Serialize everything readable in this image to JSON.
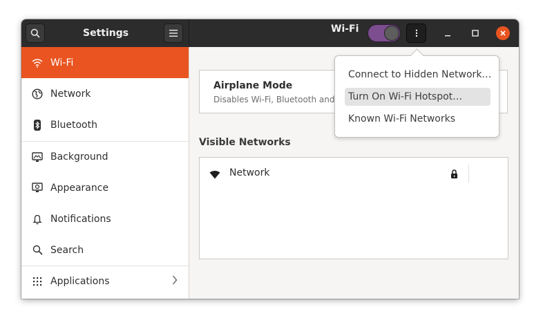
{
  "header": {
    "sidebar_title": "Settings",
    "page_title": "Wi-Fi",
    "wifi_switch_on": true
  },
  "sidebar": {
    "items": [
      {
        "label": "Wi-Fi",
        "icon": "wifi-icon",
        "active": true
      },
      {
        "label": "Network",
        "icon": "globe-icon"
      },
      {
        "label": "Bluetooth",
        "icon": "bluetooth-icon"
      },
      {
        "label": "Background",
        "icon": "monitor-icon"
      },
      {
        "label": "Appearance",
        "icon": "appearance-icon"
      },
      {
        "label": "Notifications",
        "icon": "bell-icon"
      },
      {
        "label": "Search",
        "icon": "search-icon"
      },
      {
        "label": "Applications",
        "icon": "apps-grid-icon"
      }
    ]
  },
  "main": {
    "airplane_title": "Airplane Mode",
    "airplane_subtitle": "Disables Wi-Fi, Bluetooth and",
    "visible_networks_label": "Visible Networks",
    "networks": [
      {
        "name": "Network",
        "secured": true
      }
    ]
  },
  "menu": {
    "items": [
      {
        "label": "Connect to Hidden Network…"
      },
      {
        "label": "Turn On Wi-Fi Hotspot…",
        "highlighted": true
      },
      {
        "label": "Known Wi-Fi Networks"
      }
    ]
  },
  "colors": {
    "accent": "#e95420",
    "header_bg": "#2c2c2c",
    "switch_on": "#7c4d8f"
  }
}
